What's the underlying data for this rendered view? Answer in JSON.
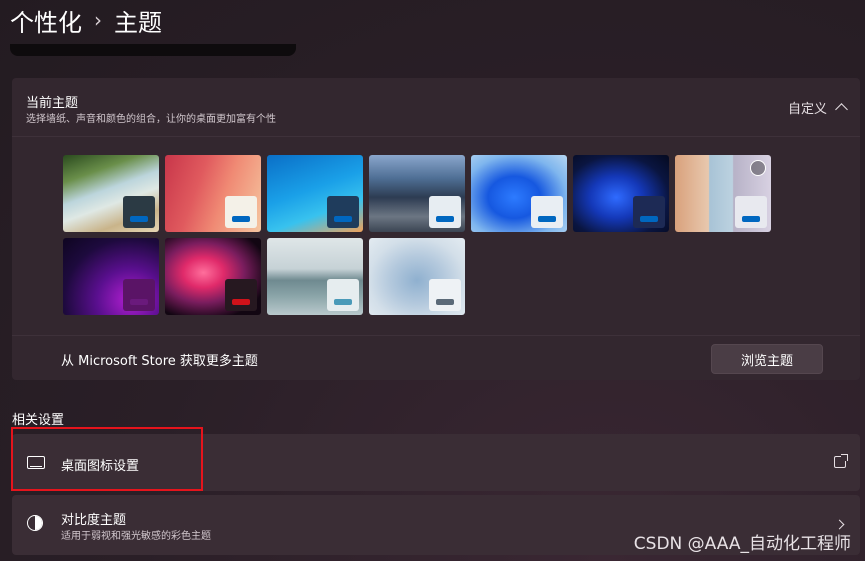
{
  "header": {
    "breadcrumb_parent": "个性化",
    "breadcrumb_sep": "›",
    "breadcrumb_current": "主题"
  },
  "current_theme": {
    "title": "当前主题",
    "subtitle": "选择墙纸、声音和颜色的组合，让你的桌面更加富有个性",
    "value": "自定义"
  },
  "themes": [
    {
      "name": "theme-1"
    },
    {
      "name": "theme-2"
    },
    {
      "name": "theme-3"
    },
    {
      "name": "theme-4"
    },
    {
      "name": "theme-5"
    },
    {
      "name": "theme-6"
    },
    {
      "name": "theme-7"
    },
    {
      "name": "theme-8"
    },
    {
      "name": "theme-9"
    },
    {
      "name": "theme-10"
    },
    {
      "name": "theme-11"
    }
  ],
  "store": {
    "text": "从 Microsoft Store 获取更多主题",
    "button": "浏览主题"
  },
  "related": {
    "title": "相关设置",
    "desktop_icons": {
      "label": "桌面图标设置"
    },
    "contrast": {
      "label": "对比度主题",
      "sub": "适用于弱视和强光敏感的彩色主题"
    }
  },
  "watermark": "CSDN @AAA_自动化工程师",
  "colors": {
    "highlight": "#e5141c",
    "accent": "#0067c0"
  }
}
